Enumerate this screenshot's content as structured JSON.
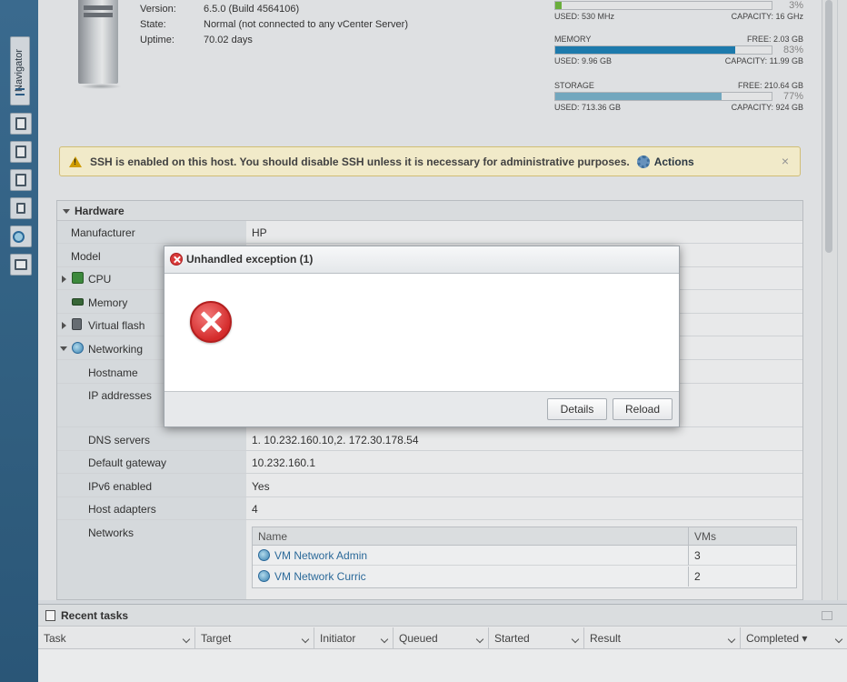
{
  "navigator": {
    "label": "Navigator"
  },
  "host": {
    "info": [
      {
        "key": "Version:",
        "value": "6.5.0 (Build 4564106)"
      },
      {
        "key": "State:",
        "value": "Normal (not connected to any vCenter Server)"
      },
      {
        "key": "Uptime:",
        "value": "70.02 days"
      }
    ]
  },
  "resources": {
    "cpu": {
      "percent": "3%",
      "used": "USED: 530 MHz",
      "capacity": "CAPACITY: 16 GHz",
      "fill": 0.03,
      "color": "#6fb63f"
    },
    "memory": {
      "title": "MEMORY",
      "free": "FREE: 2.03 GB",
      "percent": "83%",
      "used": "USED: 9.96 GB",
      "capacity": "CAPACITY: 11.99 GB",
      "fill": 0.83,
      "color": "#1f7fb4"
    },
    "storage": {
      "title": "STORAGE",
      "free": "FREE: 210.64 GB",
      "percent": "77%",
      "used": "USED: 713.36 GB",
      "capacity": "CAPACITY: 924 GB",
      "fill": 0.77,
      "color": "#77aec6"
    }
  },
  "alert": {
    "message": "SSH is enabled on this host. You should disable SSH unless it is necessary for administrative purposes.",
    "actions": "Actions",
    "close": "×"
  },
  "hardware": {
    "title": "Hardware",
    "rows": {
      "manufacturer": {
        "label": "Manufacturer",
        "value": "HP"
      },
      "model": {
        "label": "Model"
      },
      "cpu": {
        "label": "CPU"
      },
      "memory": {
        "label": "Memory"
      },
      "virtual_flash": {
        "label": "Virtual flash"
      },
      "networking": {
        "label": "Networking"
      },
      "hostname": {
        "label": "Hostname"
      },
      "ip_addresses": {
        "label": "IP addresses"
      },
      "dns_servers": {
        "label": "DNS servers",
        "value": "1. 10.232.160.10,2. 172.30.178.54"
      },
      "default_gateway": {
        "label": "Default gateway",
        "value": "10.232.160.1"
      },
      "ipv6_enabled": {
        "label": "IPv6 enabled",
        "value": "Yes"
      },
      "host_adapters": {
        "label": "Host adapters",
        "value": "4"
      },
      "networks": {
        "label": "Networks"
      }
    },
    "networks_table": {
      "headers": {
        "name": "Name",
        "vms": "VMs"
      },
      "rows": [
        {
          "name": "VM Network Admin",
          "vms": "3"
        },
        {
          "name": "VM Network Curric",
          "vms": "2"
        }
      ]
    }
  },
  "recent_tasks": {
    "title": "Recent tasks",
    "columns": [
      "Task",
      "Target",
      "Initiator",
      "Queued",
      "Started",
      "Result",
      "Completed ▾"
    ]
  },
  "dialog": {
    "title": "Unhandled exception (1)",
    "details_label": "Details",
    "reload_label": "Reload"
  }
}
